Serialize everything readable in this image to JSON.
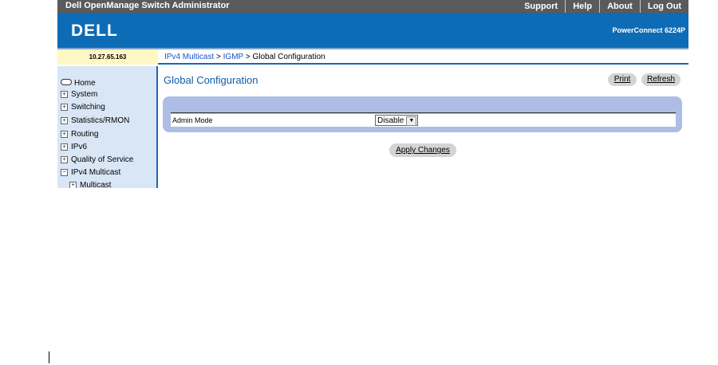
{
  "app": {
    "title": "Dell OpenManage Switch Administrator"
  },
  "toplinks": [
    {
      "label": "Support"
    },
    {
      "label": "Help"
    },
    {
      "label": "About"
    },
    {
      "label": "Log Out"
    }
  ],
  "header": {
    "logo": "DELL",
    "model": "PowerConnect 6224P"
  },
  "ip": "10.27.65.163",
  "breadcrumb": {
    "link1": "IPv4 Multicast",
    "sep1": " > ",
    "link2": "IGMP",
    "sep2": " > ",
    "current": "Global Configuration"
  },
  "sidebar": {
    "items": [
      {
        "label": "Home",
        "marker": ""
      },
      {
        "label": "System",
        "marker": "+"
      },
      {
        "label": "Switching",
        "marker": "+"
      },
      {
        "label": "Statistics/RMON",
        "marker": "+"
      },
      {
        "label": "Routing",
        "marker": "+"
      },
      {
        "label": "IPv6",
        "marker": "+"
      },
      {
        "label": "Quality of Service",
        "marker": "+"
      },
      {
        "label": "IPv4 Multicast",
        "marker": "−"
      },
      {
        "label": "Multicast",
        "marker": "+"
      }
    ]
  },
  "page": {
    "title": "Global Configuration",
    "print_label": "Print",
    "refresh_label": "Refresh",
    "admin_mode_label": "Admin Mode",
    "admin_mode_value": "Disable",
    "apply_label": "Apply Changes"
  },
  "colors": {
    "header_blue": "#0e6bb5",
    "topbar_gray": "#5a5a5a",
    "panel": "#aebde4",
    "sidebar": "#d8e6f5",
    "ip_box": "#fff7c4"
  }
}
